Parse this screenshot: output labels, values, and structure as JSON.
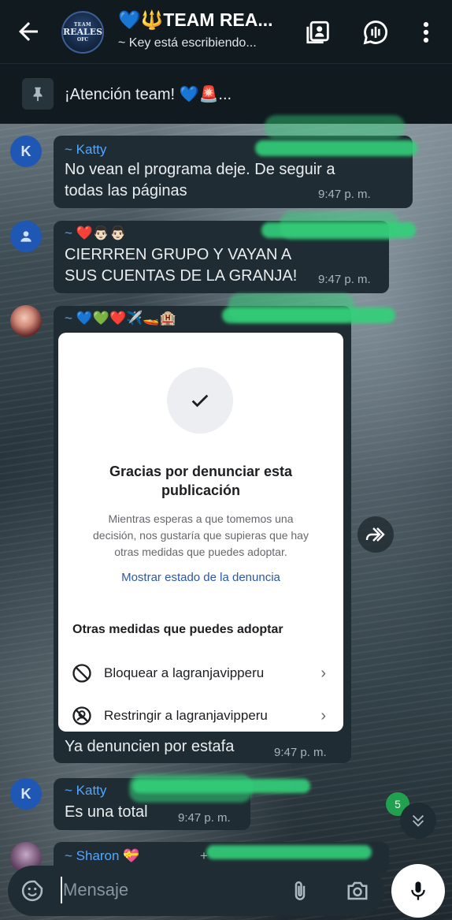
{
  "header": {
    "title": "💙🔱TEAM REA...",
    "subtitle": "~ Key está escribiendo...",
    "avatar": {
      "line1": "TEAM",
      "line2": "REALES",
      "line3": "OFC"
    },
    "icons": [
      "back-arrow-icon",
      "contact-card-icon",
      "community-icon",
      "more-options-icon"
    ]
  },
  "pinned": {
    "text": "¡Atención team! 💙🚨..."
  },
  "messages": [
    {
      "sender": "~ Katty",
      "avatar_letter": "K",
      "text": "No vean el programa deje. De seguir a todas las páginas",
      "time": "9:47 p. m."
    },
    {
      "sender": "~ ❤️👨🏻👨🏻",
      "text": "CIERRREN GRUPO Y VAYAN A SUS CUENTAS DE LA GRANJA!",
      "time": "9:47 p. m."
    },
    {
      "sender": "~ 💙💚❤️✈️🚤🏨",
      "text": "Ya denuncien por estafa",
      "time": "9:47 p. m."
    },
    {
      "sender": "~ Katty",
      "avatar_letter": "K",
      "text": "Es una total",
      "time": "9:47 p. m."
    },
    {
      "sender": "~ Sharon 💝",
      "extra": "+"
    }
  ],
  "report_card": {
    "title": "Gracias por denunciar esta publicación",
    "description": "Mientras esperas a que tomemos una decisión, nos gustaría que supieras que hay otras medidas que puedes adoptar.",
    "link": "Mostrar estado de la denuncia",
    "subtitle": "Otras medidas que puedes adoptar",
    "actions": [
      {
        "label": "Bloquear a lagranjavipperu",
        "icon": "block-icon"
      },
      {
        "label": "Restringir a lagranjavipperu",
        "icon": "restrict-icon"
      }
    ]
  },
  "unread_badge": "5",
  "composer": {
    "placeholder": "Mensaje"
  },
  "colors": {
    "accent": "#53a6fd",
    "bubble": "#1f2c33",
    "topbar": "#101a1f",
    "badge": "#21a04f",
    "redaction": "#33d17a"
  }
}
